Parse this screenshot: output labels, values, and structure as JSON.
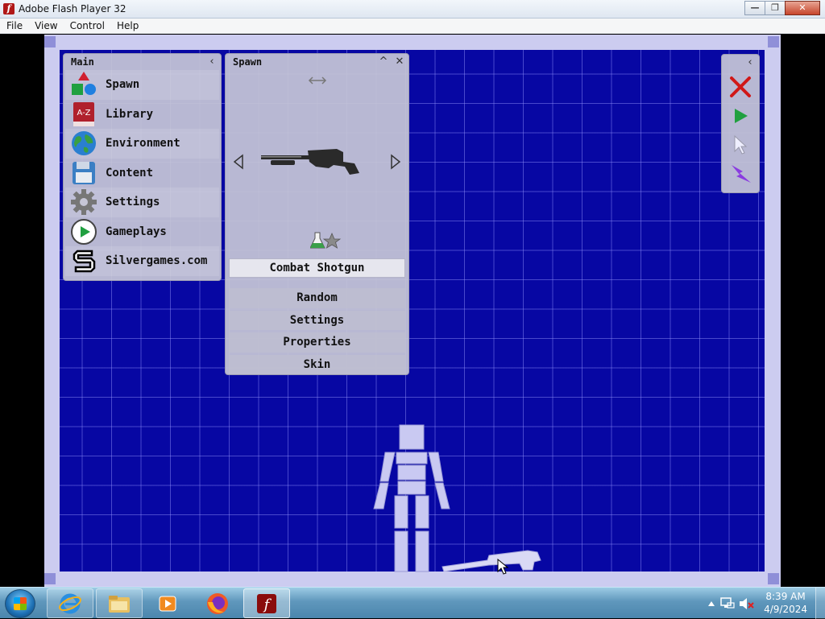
{
  "window": {
    "title": "Adobe Flash Player 32",
    "controls": {
      "minimize": "—",
      "restore": "❐",
      "close": "✕"
    }
  },
  "menu": [
    "File",
    "View",
    "Control",
    "Help"
  ],
  "main_panel": {
    "title": "Main",
    "collapse": "‹",
    "items": [
      {
        "label": "Spawn",
        "icon": "shapes-icon"
      },
      {
        "label": "Library",
        "icon": "az-book-icon"
      },
      {
        "label": "Environment",
        "icon": "globe-icon"
      },
      {
        "label": "Content",
        "icon": "floppy-disk-icon"
      },
      {
        "label": "Settings",
        "icon": "gear-icon"
      },
      {
        "label": "Gameplays",
        "icon": "play-circle-icon"
      },
      {
        "label": "Silvergames.com",
        "icon": "silvergames-logo-icon"
      }
    ]
  },
  "spawn_panel": {
    "title": "Spawn",
    "up": "^",
    "close": "✕",
    "selected_item": "Combat Shotgun",
    "options": [
      "Random",
      "Settings",
      "Properties",
      "Skin"
    ]
  },
  "tools": [
    "delete-icon",
    "play-icon",
    "pointer-icon",
    "lightning-icon"
  ],
  "taskbar": {
    "apps": [
      "internet-explorer-icon",
      "file-explorer-icon",
      "media-player-icon",
      "firefox-icon",
      "flash-player-icon"
    ],
    "time": "8:39 AM",
    "date": "4/9/2024"
  },
  "colors": {
    "grid_background": "#0707a3",
    "panel": "#c6c6d6",
    "frame": "#ccccf0"
  }
}
